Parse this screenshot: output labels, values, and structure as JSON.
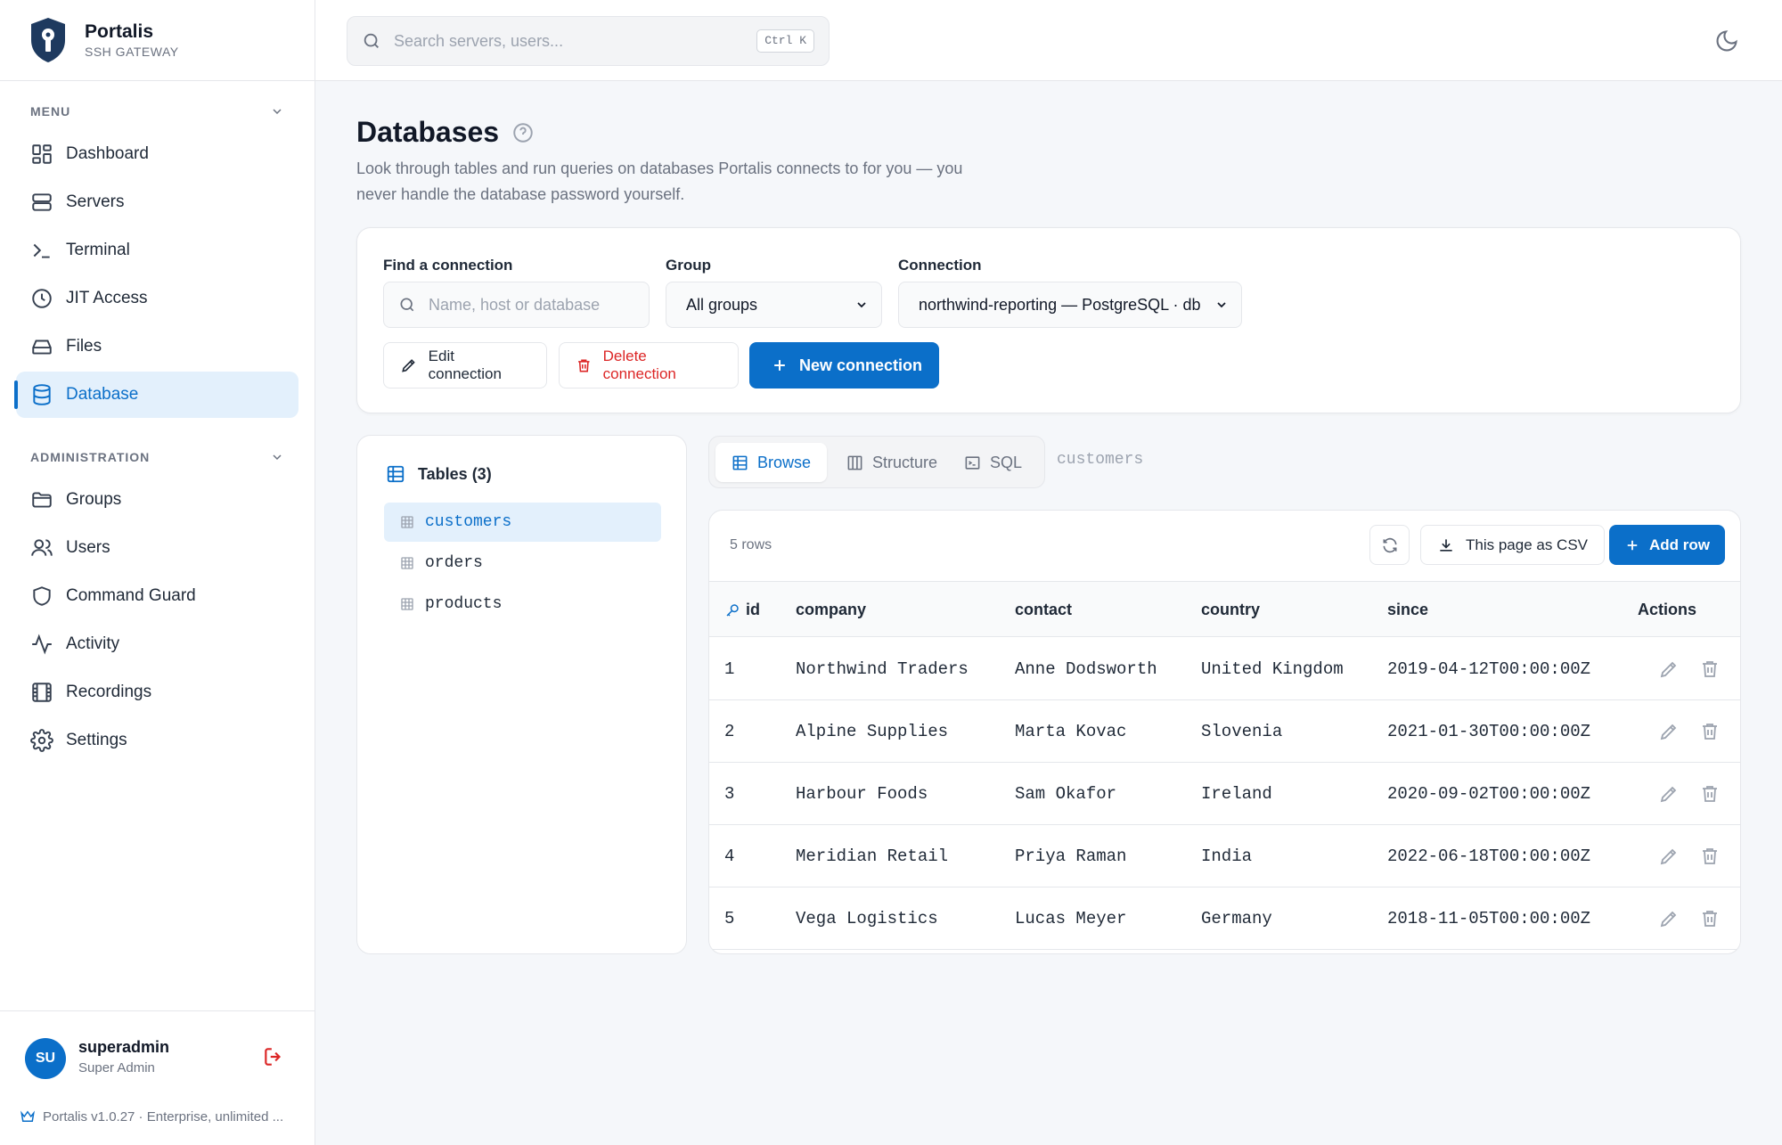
{
  "brand": {
    "name": "Portalis",
    "subtitle": "SSH GATEWAY"
  },
  "sidebar": {
    "menu_label": "MENU",
    "menu_items": [
      {
        "label": "Dashboard",
        "icon": "dashboard-icon"
      },
      {
        "label": "Servers",
        "icon": "server-icon"
      },
      {
        "label": "Terminal",
        "icon": "terminal-icon"
      },
      {
        "label": "JIT Access",
        "icon": "clock-icon"
      },
      {
        "label": "Files",
        "icon": "drive-icon"
      },
      {
        "label": "Database",
        "icon": "database-icon",
        "active": true
      }
    ],
    "admin_label": "ADMINISTRATION",
    "admin_items": [
      {
        "label": "Groups",
        "icon": "folder-icon"
      },
      {
        "label": "Users",
        "icon": "users-icon"
      },
      {
        "label": "Command Guard",
        "icon": "shield-icon"
      },
      {
        "label": "Activity",
        "icon": "activity-icon"
      },
      {
        "label": "Recordings",
        "icon": "film-icon"
      },
      {
        "label": "Settings",
        "icon": "gear-icon"
      }
    ],
    "user": {
      "initials": "SU",
      "name": "superadmin",
      "role": "Super Admin"
    },
    "version": "Portalis v1.0.27 · Enterprise, unlimited ..."
  },
  "topbar": {
    "search_placeholder": "Search servers, users...",
    "shortcut": "Ctrl K"
  },
  "page": {
    "title": "Databases",
    "description": "Look through tables and run queries on databases Portalis connects to for you — you never handle the database password yourself."
  },
  "connection": {
    "find_label": "Find a connection",
    "find_placeholder": "Name, host or database",
    "group_label": "Group",
    "group_value": "All groups",
    "connection_label": "Connection",
    "connection_value": "northwind-reporting — PostgreSQL · db",
    "edit_label": "Edit connection",
    "delete_label": "Delete connection",
    "new_label": "New connection"
  },
  "tables": {
    "heading": "Tables (3)",
    "items": [
      "customers",
      "orders",
      "products"
    ],
    "selected": "customers"
  },
  "tabs": {
    "browse": "Browse",
    "structure": "Structure",
    "sql": "SQL",
    "current": "customers"
  },
  "grid": {
    "row_count": "5 rows",
    "csv_label": "This page as CSV",
    "add_label": "Add row",
    "columns": [
      "id",
      "company",
      "contact",
      "country",
      "since",
      "Actions"
    ],
    "rows": [
      [
        "1",
        "Northwind Traders",
        "Anne Dodsworth",
        "United Kingdom",
        "2019-04-12T00:00:00Z"
      ],
      [
        "2",
        "Alpine Supplies",
        "Marta Kovac",
        "Slovenia",
        "2021-01-30T00:00:00Z"
      ],
      [
        "3",
        "Harbour Foods",
        "Sam Okafor",
        "Ireland",
        "2020-09-02T00:00:00Z"
      ],
      [
        "4",
        "Meridian Retail",
        "Priya Raman",
        "India",
        "2022-06-18T00:00:00Z"
      ],
      [
        "5",
        "Vega Logistics",
        "Lucas Meyer",
        "Germany",
        "2018-11-05T00:00:00Z"
      ]
    ]
  },
  "colors": {
    "accent": "#0b6fc9",
    "danger": "#dc2626",
    "active_bg": "#e3f0fc"
  }
}
